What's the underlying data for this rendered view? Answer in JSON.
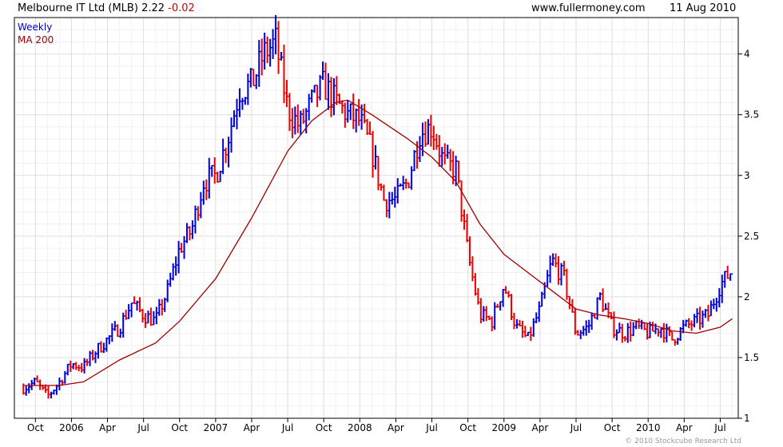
{
  "header": {
    "title": "Melbourne IT Ltd (MLB)",
    "price": "2.22",
    "change": "-0.02",
    "website": "www.fullermoney.com",
    "date": "11 Aug 2010"
  },
  "legend": {
    "weekly_label": "Weekly",
    "ma_label": "MA 200",
    "weekly_color": "#0000cc",
    "ma_color": "#a00000"
  },
  "footer": {
    "copyright": "© 2010 Stockcube Research Ltd"
  },
  "colors": {
    "up": "#0000dd",
    "down": "#ee0000",
    "ma": "#a00000",
    "grid": "#dddddd"
  },
  "chart_data": {
    "type": "line",
    "title": "Melbourne IT Ltd (MLB) 2.22 -0.02",
    "legend": [
      "Weekly",
      "MA 200"
    ],
    "legend_position": "top-left",
    "y_axis_position": "right",
    "ylim": [
      1,
      4.3
    ],
    "yticks": [
      1,
      1.5,
      2,
      2.5,
      3,
      3.5,
      4
    ],
    "xlabels": [
      "Oct",
      "2006",
      "Apr",
      "Jul",
      "Oct",
      "2007",
      "Apr",
      "Jul",
      "Oct",
      "2008",
      "Apr",
      "Jul",
      "Oct",
      "2009",
      "Apr",
      "Jul",
      "Oct",
      "2010",
      "Apr",
      "Jul"
    ],
    "grid": true,
    "series": [
      {
        "name": "Weekly",
        "style": "weekly price bars (blue up, red down)",
        "x": [
          "2005-09",
          "2005-10",
          "2005-11",
          "2005-12",
          "2006-01",
          "2006-02",
          "2006-03",
          "2006-04",
          "2006-05",
          "2006-06",
          "2006-07",
          "2006-08",
          "2006-09",
          "2006-10",
          "2006-11",
          "2006-12",
          "2007-01",
          "2007-02",
          "2007-03",
          "2007-04",
          "2007-05",
          "2007-06",
          "2007-07",
          "2007-08",
          "2007-09",
          "2007-10",
          "2007-11",
          "2007-12",
          "2008-01",
          "2008-02",
          "2008-03",
          "2008-04",
          "2008-05",
          "2008-06",
          "2008-07",
          "2008-08",
          "2008-09",
          "2008-10",
          "2008-11",
          "2008-12",
          "2009-01",
          "2009-02",
          "2009-03",
          "2009-04",
          "2009-05",
          "2009-06",
          "2009-07",
          "2009-08",
          "2009-09",
          "2009-10",
          "2009-11",
          "2009-12",
          "2010-01",
          "2010-02",
          "2010-03",
          "2010-04",
          "2010-05",
          "2010-06",
          "2010-07",
          "2010-08"
        ],
        "values": [
          1.25,
          1.3,
          1.18,
          1.3,
          1.45,
          1.42,
          1.55,
          1.65,
          1.75,
          1.95,
          1.85,
          1.8,
          2.05,
          2.4,
          2.55,
          2.95,
          3.0,
          3.3,
          3.7,
          3.75,
          4.0,
          4.1,
          3.55,
          3.4,
          3.6,
          3.75,
          3.6,
          3.5,
          3.45,
          3.2,
          2.8,
          2.8,
          2.95,
          3.35,
          3.4,
          3.1,
          3.05,
          2.35,
          1.85,
          1.8,
          2.1,
          1.75,
          1.65,
          1.9,
          2.3,
          2.15,
          1.7,
          1.75,
          2.0,
          1.75,
          1.7,
          1.75,
          1.7,
          1.75,
          1.65,
          1.75,
          1.8,
          1.85,
          2.1,
          2.22
        ]
      },
      {
        "name": "MA 200",
        "x": [
          "2005-09",
          "2005-12",
          "2006-02",
          "2006-05",
          "2006-08",
          "2006-10",
          "2007-01",
          "2007-04",
          "2007-07",
          "2007-09",
          "2007-11",
          "2007-12",
          "2008-02",
          "2008-05",
          "2008-07",
          "2008-09",
          "2008-11",
          "2009-01",
          "2009-03",
          "2009-05",
          "2009-07",
          "2009-09",
          "2009-11",
          "2010-01",
          "2010-03",
          "2010-05",
          "2010-07",
          "2010-08"
        ],
        "values": [
          1.27,
          1.27,
          1.3,
          1.48,
          1.62,
          1.8,
          2.15,
          2.65,
          3.2,
          3.45,
          3.6,
          3.62,
          3.5,
          3.3,
          3.15,
          2.95,
          2.6,
          2.35,
          2.2,
          2.05,
          1.9,
          1.85,
          1.82,
          1.78,
          1.72,
          1.7,
          1.75,
          1.82
        ]
      }
    ]
  }
}
